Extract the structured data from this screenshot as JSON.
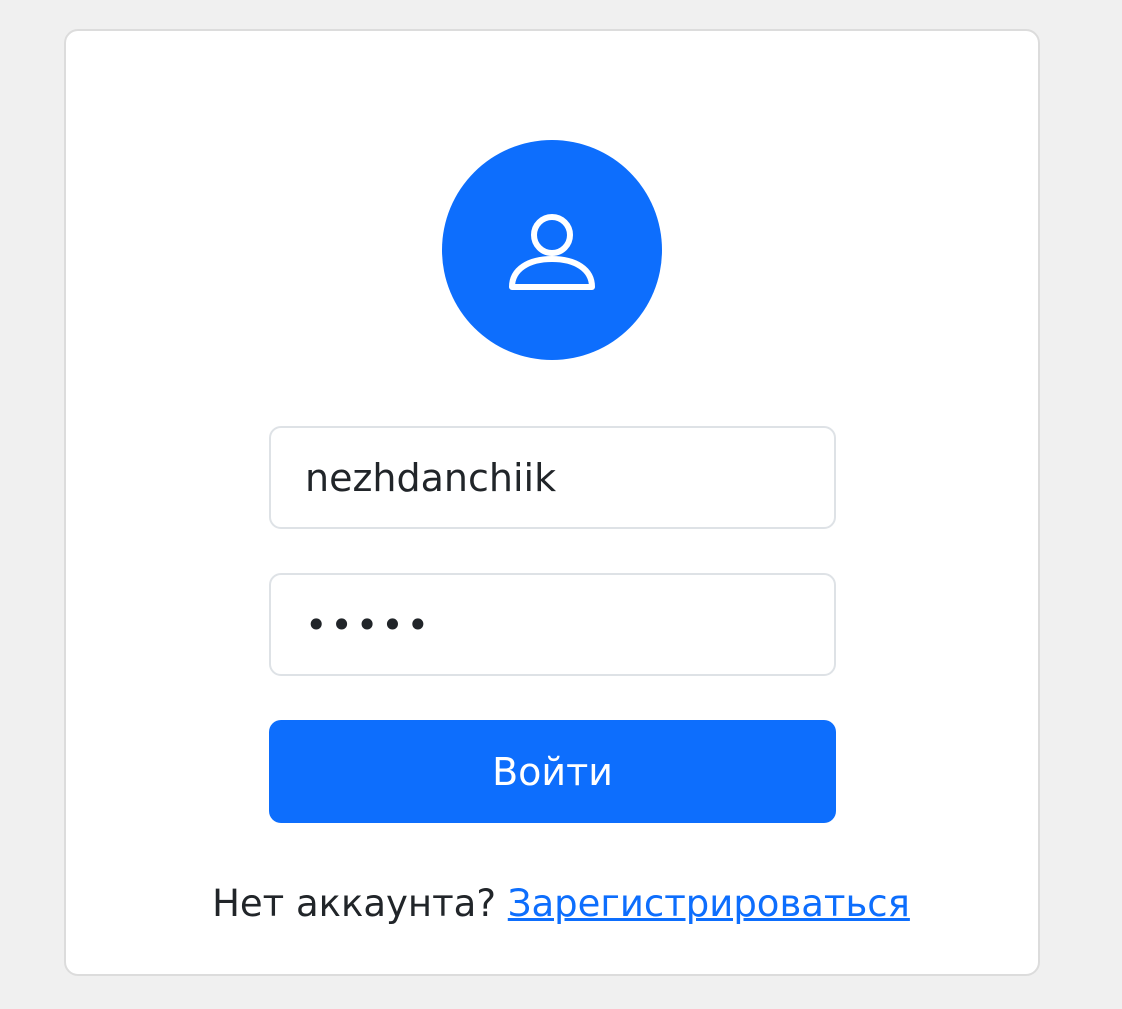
{
  "login": {
    "avatar_icon": "user-icon",
    "username_value": "nezhdanchiik",
    "password_value": "12345",
    "submit_label": "Войти",
    "no_account_text": "Нет аккаунта?",
    "register_link": "Зарегистрироваться"
  },
  "colors": {
    "accent": "#0d6efd",
    "background": "#f0f0f0",
    "card": "#ffffff",
    "border": "#dcdcdc",
    "text": "#212529"
  }
}
